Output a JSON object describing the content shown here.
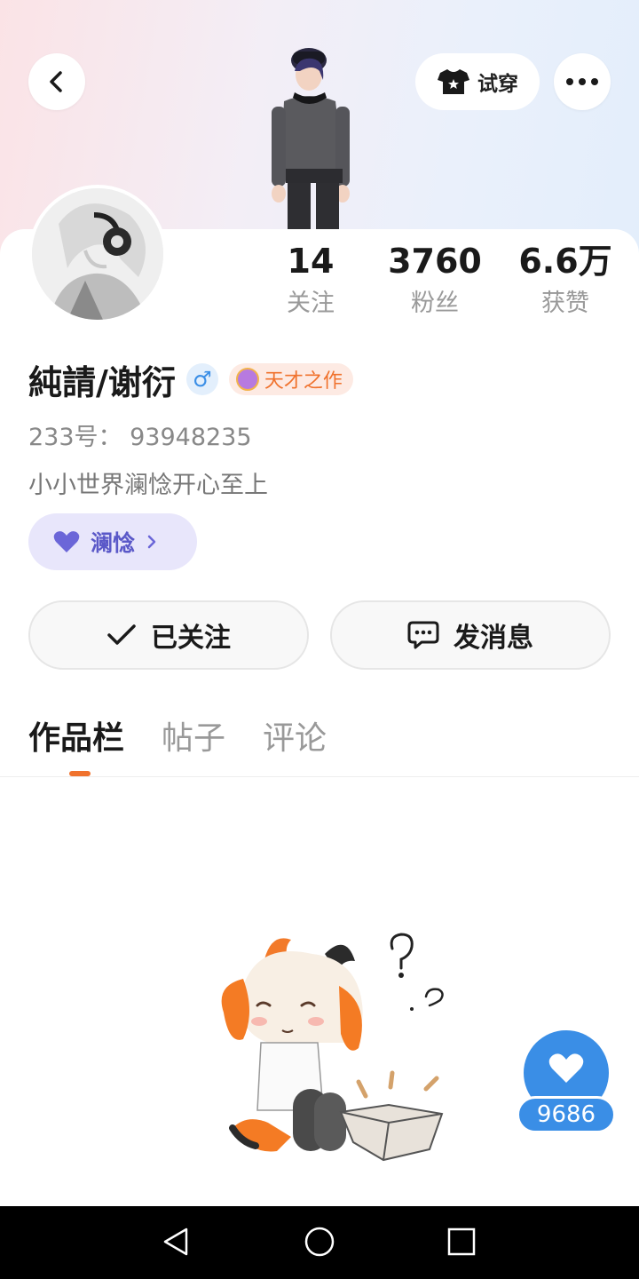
{
  "header": {
    "try_on_label": "试穿"
  },
  "stats": {
    "following": {
      "value": "14",
      "label": "关注"
    },
    "fans": {
      "value": "3760",
      "label": "粉丝"
    },
    "likes": {
      "value": "6.6万",
      "label": "获赞"
    }
  },
  "profile": {
    "name": "純請/谢衍",
    "gender_symbol": "♂",
    "medal": "天才之作",
    "uid": "233号：  93948235",
    "bio": "小小世界澜惗开心至上",
    "fan_tag": "澜惗"
  },
  "actions": {
    "follow_label": "已关注",
    "message_label": "发消息"
  },
  "tabs": [
    {
      "label": "作品栏",
      "active": true
    },
    {
      "label": "帖子",
      "active": false
    },
    {
      "label": "评论",
      "active": false
    }
  ],
  "like_fab": {
    "count": "9686"
  },
  "colors": {
    "accent_orange": "#f0722d",
    "accent_blue": "#3a8ee6",
    "fan_tag_purple": "#5a58c8"
  }
}
